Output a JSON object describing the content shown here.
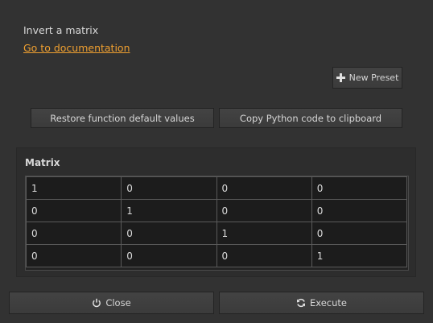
{
  "description": "Invert a matrix",
  "doc_link": "Go to documentation",
  "buttons": {
    "new_preset": "New Preset",
    "restore": "Restore function default values",
    "copy_python": "Copy Python code to clipboard",
    "close": "Close",
    "execute": "Execute"
  },
  "matrix": {
    "title": "Matrix",
    "rows": [
      [
        "1",
        "0",
        "0",
        "0"
      ],
      [
        "0",
        "1",
        "0",
        "0"
      ],
      [
        "0",
        "0",
        "1",
        "0"
      ],
      [
        "0",
        "0",
        "0",
        "1"
      ]
    ]
  },
  "icons": {
    "new_preset": "plus-icon",
    "close": "power-icon",
    "execute": "refresh-icon"
  },
  "colors": {
    "background": "#323232",
    "link": "#f0a030",
    "button": "#3f3f3f",
    "cell": "#1c1c1c"
  }
}
